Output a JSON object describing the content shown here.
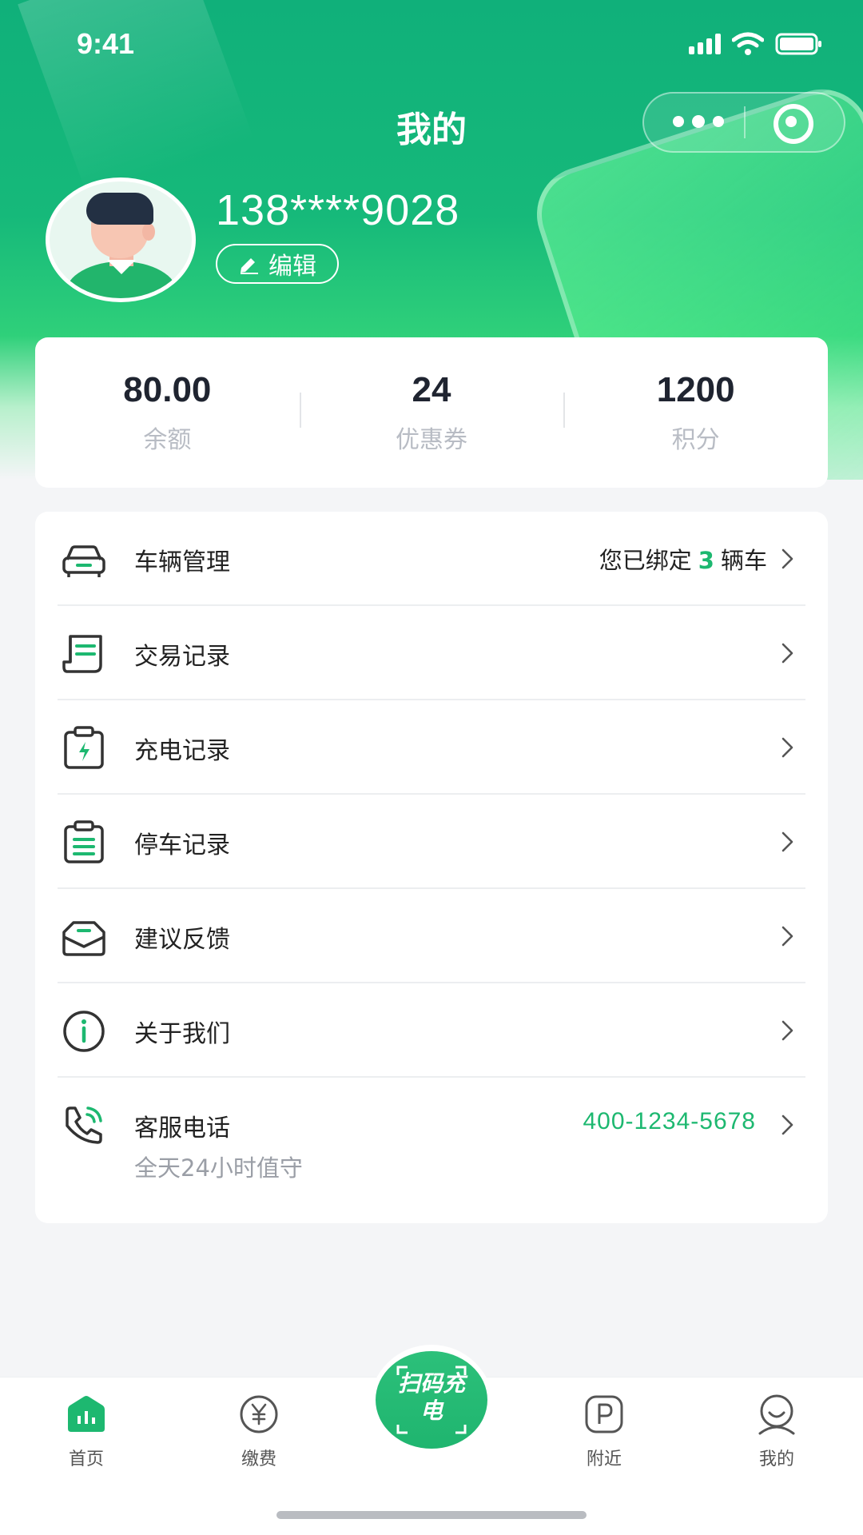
{
  "status_bar": {
    "time": "9:41"
  },
  "nav": {
    "title": "我的"
  },
  "profile": {
    "phone": "138****9028",
    "edit_label": "编辑"
  },
  "stats": [
    {
      "value": "80.00",
      "label": "余额"
    },
    {
      "value": "24",
      "label": "优惠券"
    },
    {
      "value": "1200",
      "label": "积分"
    }
  ],
  "menu": {
    "vehicle": {
      "label": "车辆管理",
      "extra_prefix": "您已绑定",
      "extra_count": "3",
      "extra_suffix": "辆车"
    },
    "transactions": {
      "label": "交易记录"
    },
    "charging": {
      "label": "充电记录"
    },
    "parking": {
      "label": "停车记录"
    },
    "feedback": {
      "label": "建议反馈"
    },
    "about": {
      "label": "关于我们"
    },
    "service": {
      "label": "客服电话",
      "sub": "全天24小时值守",
      "hotline": "400-1234-5678"
    }
  },
  "tabbar": {
    "home": "首页",
    "pay": "缴费",
    "scan": "扫码充电",
    "nearby": "附近",
    "mine": "我的"
  },
  "colors": {
    "accent": "#1db870",
    "header": "#10b07a"
  }
}
